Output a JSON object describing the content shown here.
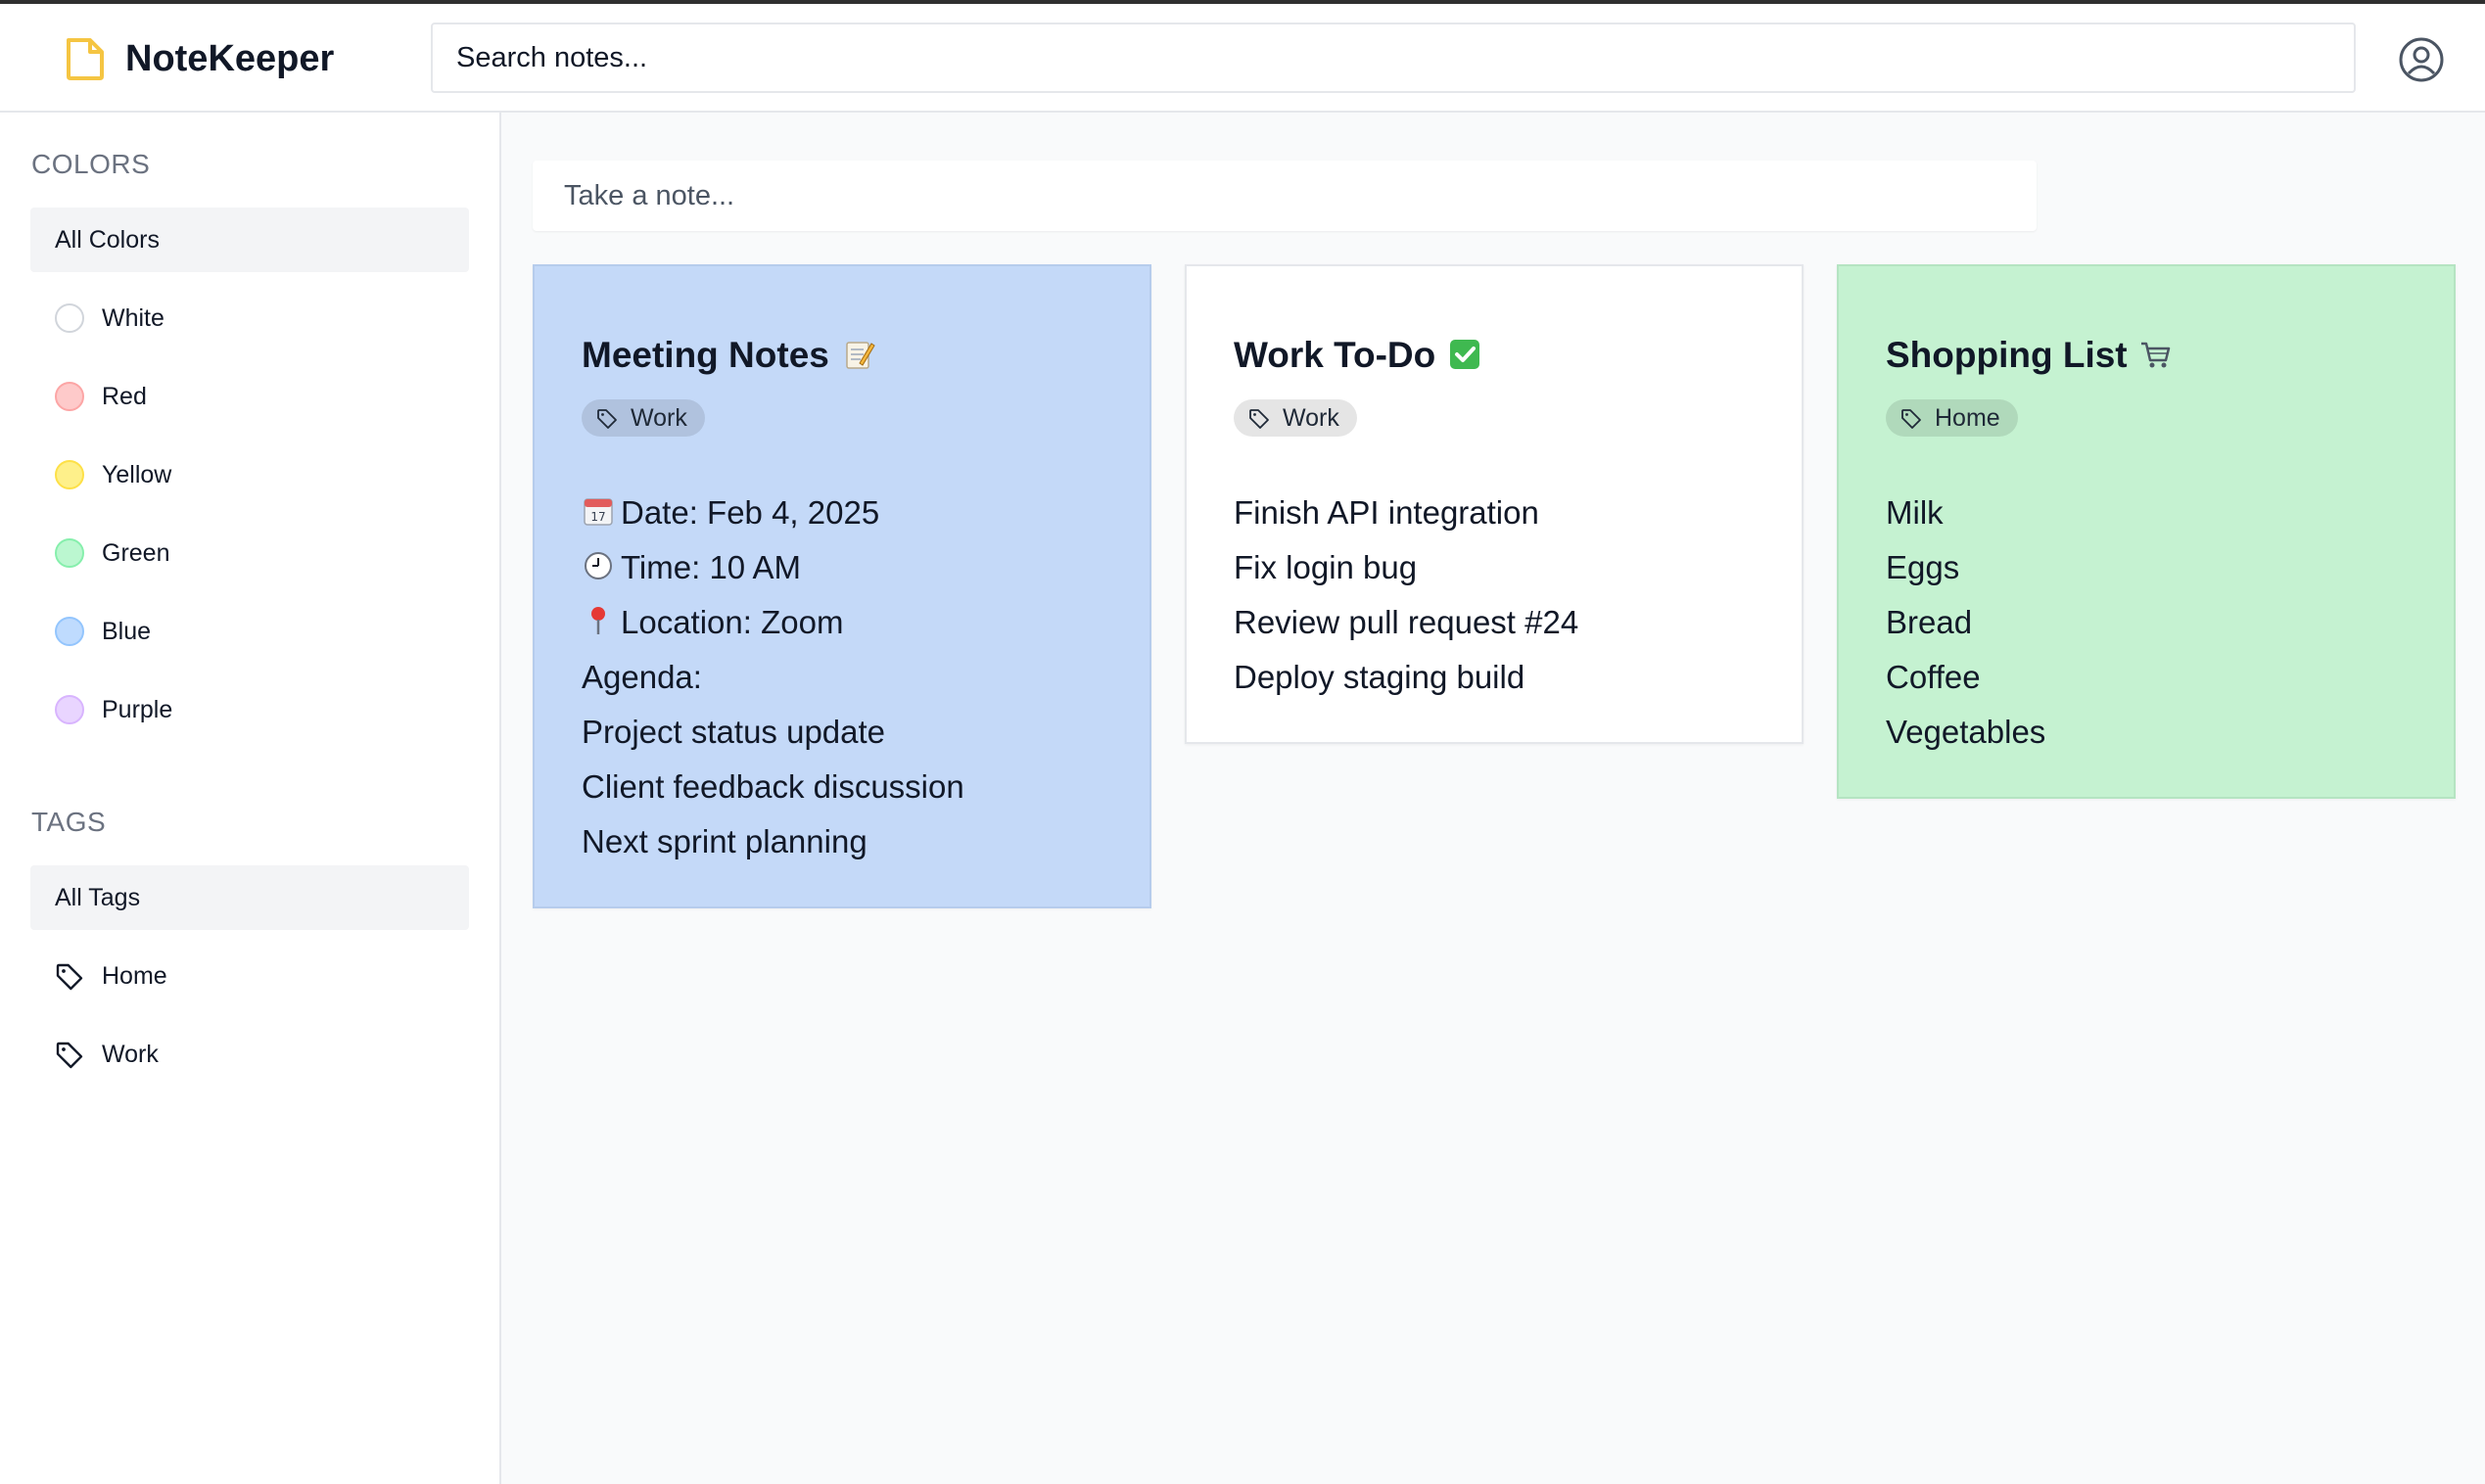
{
  "app": {
    "title": "NoteKeeper"
  },
  "search": {
    "placeholder": "Search notes..."
  },
  "sidebar": {
    "colors_title": "COLORS",
    "all_colors_label": "All Colors",
    "colors": [
      {
        "label": "White",
        "color": "#ffffff"
      },
      {
        "label": "Red",
        "color": "#fecaca"
      },
      {
        "label": "Yellow",
        "color": "#fef08a"
      },
      {
        "label": "Green",
        "color": "#bbf7d0"
      },
      {
        "label": "Blue",
        "color": "#bfdbfe"
      },
      {
        "label": "Purple",
        "color": "#e9d5ff"
      }
    ],
    "tags_title": "TAGS",
    "all_tags_label": "All Tags",
    "tags": [
      {
        "label": "Home"
      },
      {
        "label": "Work"
      }
    ]
  },
  "composer": {
    "placeholder": "Take a note..."
  },
  "notes": [
    {
      "title": "Meeting Notes",
      "title_icon": "memo-emoji",
      "tag": "Work",
      "color": "#c4d9f8",
      "lines": [
        {
          "icon": "calendar-emoji",
          "text": "Date: Feb 4, 2025"
        },
        {
          "icon": "clock-emoji",
          "text": "Time: 10 AM"
        },
        {
          "icon": "pin-emoji",
          "text": "Location: Zoom"
        },
        {
          "text": "Agenda:"
        },
        {
          "text": "Project status update"
        },
        {
          "text": "Client feedback discussion"
        },
        {
          "text": "Next sprint planning"
        }
      ]
    },
    {
      "title": "Work To-Do",
      "title_icon": "check-mark-emoji",
      "tag": "Work",
      "color": "#ffffff",
      "lines": [
        {
          "text": "Finish API integration"
        },
        {
          "text": "Fix login bug"
        },
        {
          "text": "Review pull request #24"
        },
        {
          "text": "Deploy staging build"
        }
      ]
    },
    {
      "title": "Shopping List",
      "title_icon": "cart-emoji",
      "tag": "Home",
      "color": "#c5f2d1",
      "lines": [
        {
          "text": "Milk"
        },
        {
          "text": "Eggs"
        },
        {
          "text": "Bread"
        },
        {
          "text": "Coffee"
        },
        {
          "text": "Vegetables"
        }
      ]
    }
  ],
  "colors": {
    "logo": "#f5c542",
    "header_bg": "#ffffff",
    "page_bg": "#f9fafb"
  }
}
